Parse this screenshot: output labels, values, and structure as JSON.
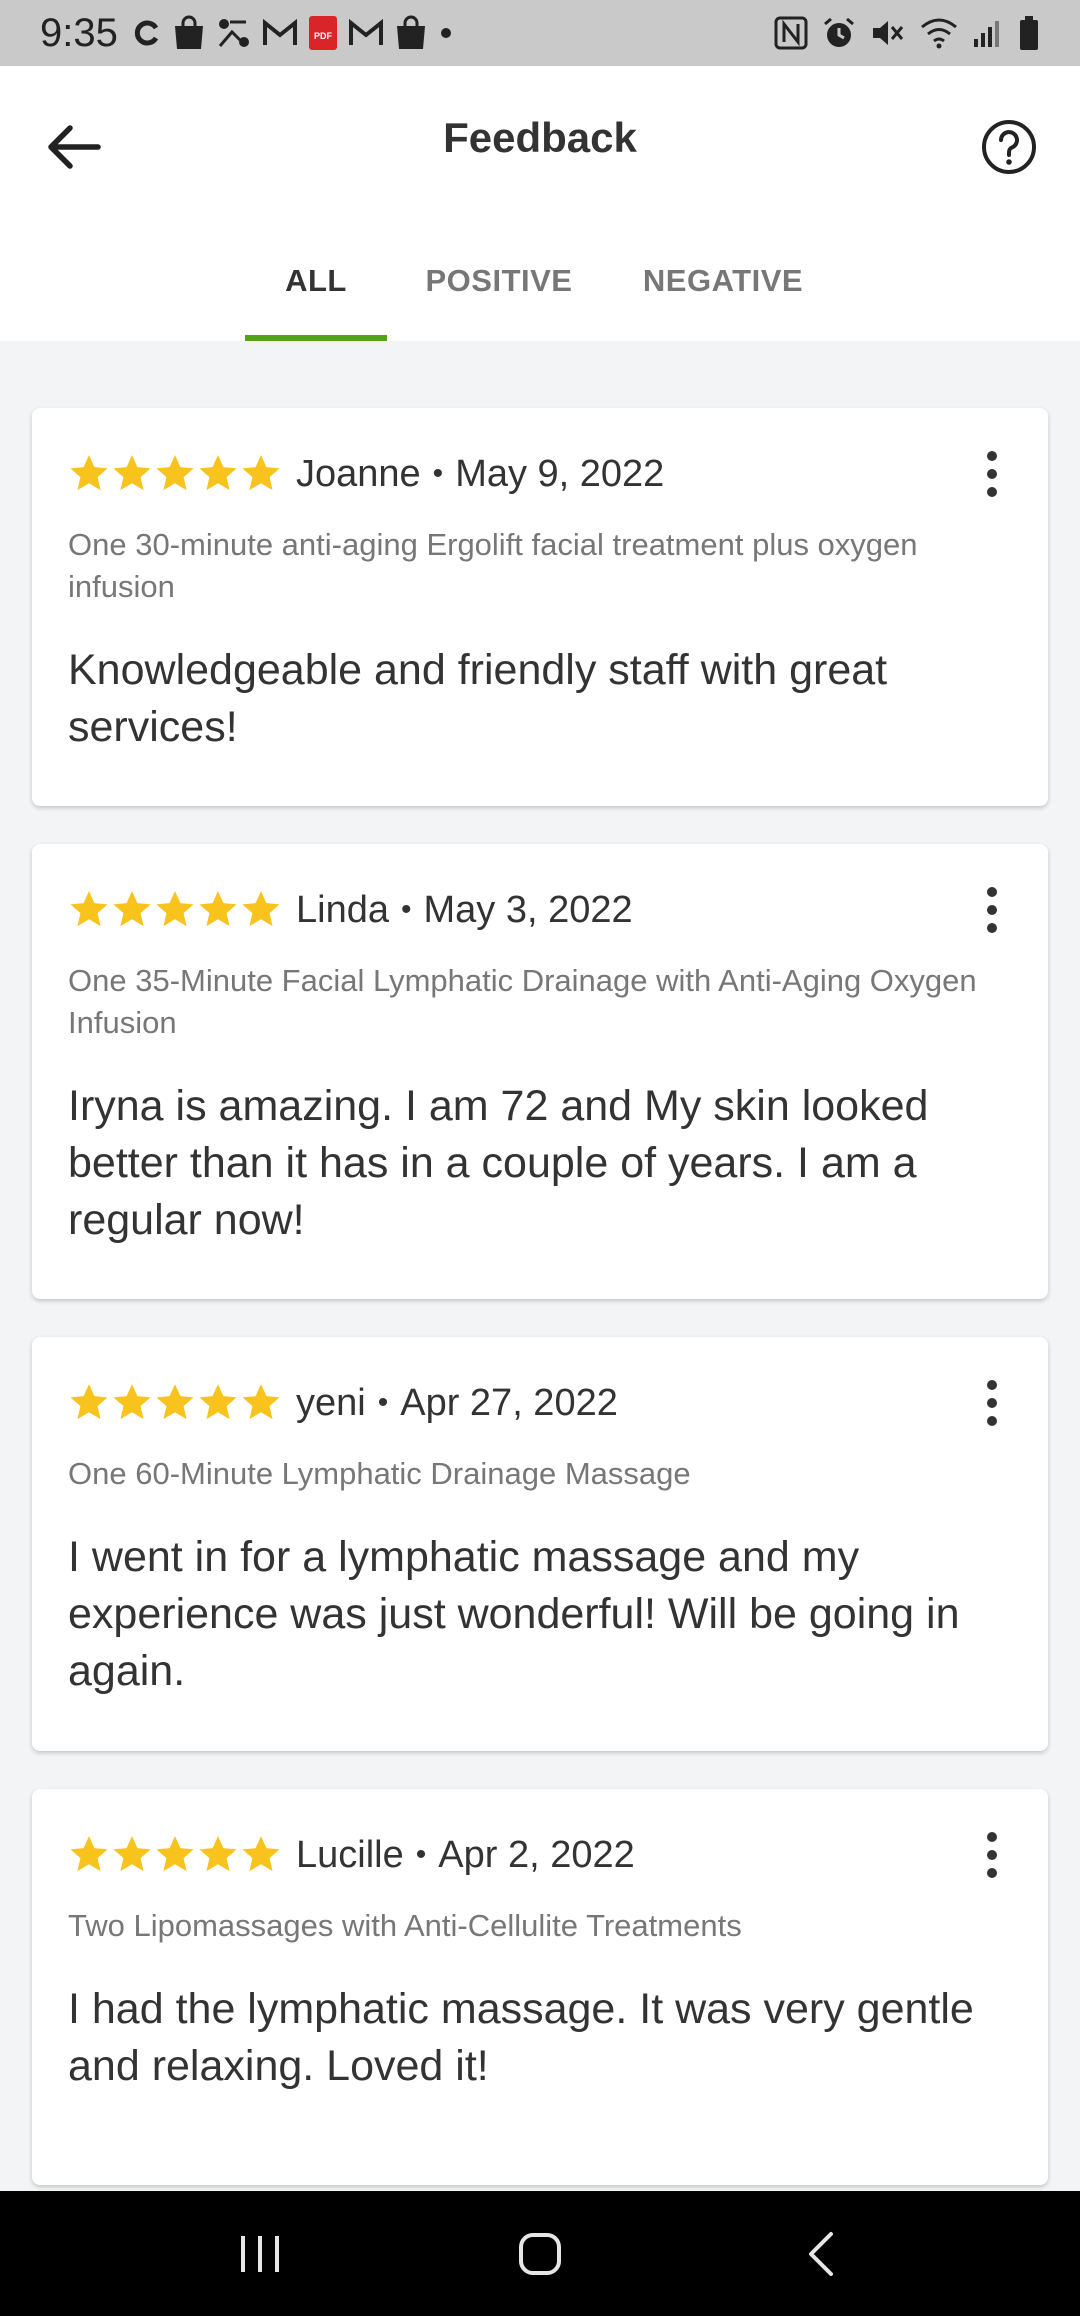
{
  "status_bar": {
    "time": "9:35",
    "left_icons": [
      "sync-icon",
      "shopping-bag-icon",
      "route-icon",
      "gmail-icon",
      "pdf-icon",
      "gmail-icon",
      "shopping-bag-icon",
      "more-dot-icon"
    ],
    "pdf_label": "PDF",
    "right_icons": [
      "nfc-icon",
      "alarm-icon",
      "mute-icon",
      "wifi-icon",
      "signal-icon",
      "battery-icon"
    ]
  },
  "header": {
    "title": "Feedback",
    "back_icon": "arrow-left-icon",
    "help_icon": "question-circle-icon"
  },
  "tabs": [
    {
      "label": "ALL",
      "active": true
    },
    {
      "label": "POSITIVE",
      "active": false
    },
    {
      "label": "NEGATIVE",
      "active": false
    }
  ],
  "accent_color": "#53a318",
  "star_color": "#f7c31c",
  "reviews": [
    {
      "rating": 5,
      "name": "Joanne",
      "separator": "•",
      "date": "May 9, 2022",
      "deal": "One 30-minute anti-aging Ergolift facial treatment plus oxygen infusion",
      "text": "Knowledgeable and friendly staff with great services!"
    },
    {
      "rating": 5,
      "name": "Linda",
      "separator": "•",
      "date": "May 3, 2022",
      "deal": "One 35-Minute Facial Lymphatic Drainage with Anti-Aging Oxygen Infusion",
      "text": "Iryna is amazing. I am 72 and My skin looked better than it has in a couple of years.  I am a regular now!"
    },
    {
      "rating": 5,
      "name": "yeni",
      "separator": "•",
      "date": "Apr 27, 2022",
      "deal": "One 60-Minute Lymphatic Drainage Massage",
      "text": "I went in for a lymphatic massage and my experience was just wonderful! Will be going in again."
    },
    {
      "rating": 5,
      "name": "Lucille",
      "separator": "•",
      "date": "Apr 2, 2022",
      "deal": "Two Lipomassages with Anti-Cellulite Treatments",
      "text": "I had the lymphatic massage. It was very gentle and relaxing. Loved it!"
    }
  ],
  "nav_bar": {
    "buttons": [
      "recent-apps-icon",
      "home-icon",
      "back-icon"
    ]
  }
}
